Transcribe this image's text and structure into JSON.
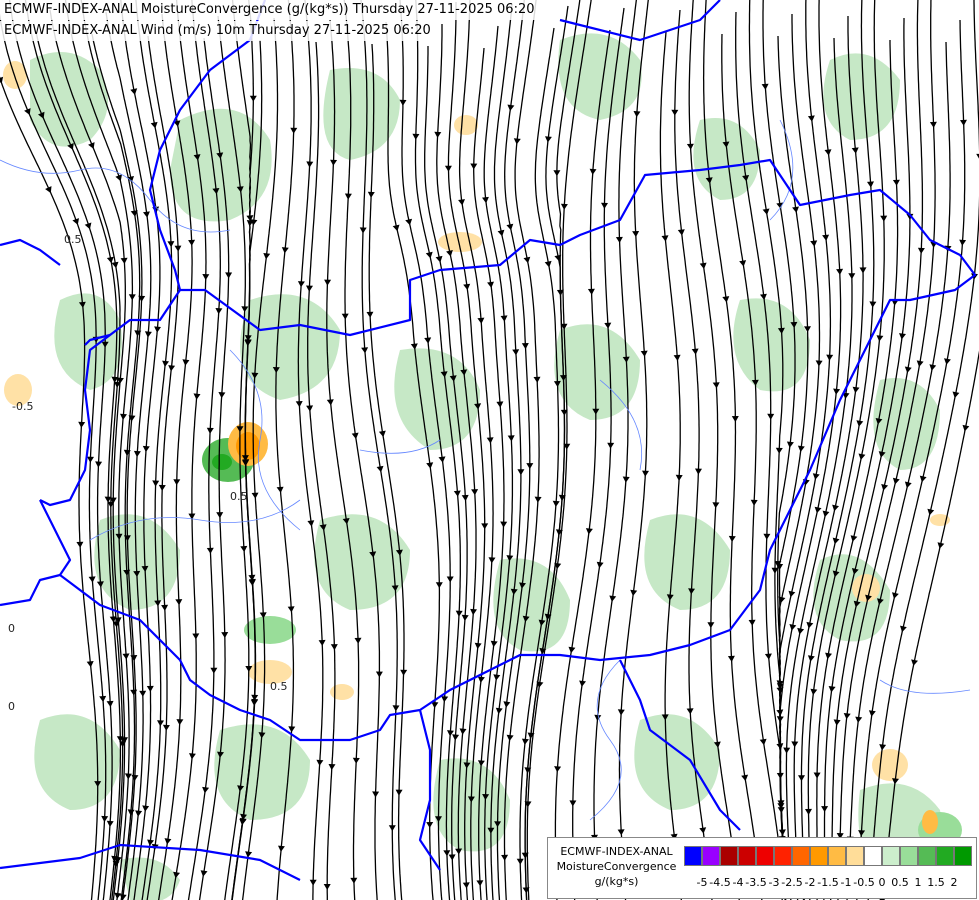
{
  "titles": {
    "line1": "ECMWF-INDEX-ANAL MoistureConvergence (g/(kg*s)) Thursday 27-11-2025 06:20",
    "line2": "ECMWF-INDEX-ANAL Wind (m/s) 10m Thursday 27-11-2025 06:20"
  },
  "legend": {
    "model": "ECMWF-INDEX-ANAL",
    "parameter": "MoistureConvergence",
    "unit": "g/(kg*s)",
    "ticks": [
      "-5",
      "-4.5",
      "-4",
      "-3.5",
      "-3",
      "-2.5",
      "-2",
      "-1.5",
      "-1",
      "-0.5",
      "0",
      "0.5",
      "1",
      "1.5",
      "2"
    ],
    "colors": [
      "#0000ff",
      "#9900ff",
      "#aa0000",
      "#cc0000",
      "#ee0000",
      "#ff2200",
      "#ff6600",
      "#ff9900",
      "#ffbb44",
      "#ffdd99",
      "#ffffff",
      "#cceecc",
      "#99dd99",
      "#55bb55",
      "#22aa22",
      "#009900"
    ]
  },
  "map_labels": {
    "contour_values": [
      "0.5",
      "0.5",
      "-0.5",
      "0.5",
      "0",
      "0"
    ]
  },
  "colors": {
    "border": "#0000ff",
    "river": "#6688ff",
    "streamline": "#000000",
    "positive_fill": "#c6e8c6",
    "negative_fill": "#ffe1a6"
  }
}
